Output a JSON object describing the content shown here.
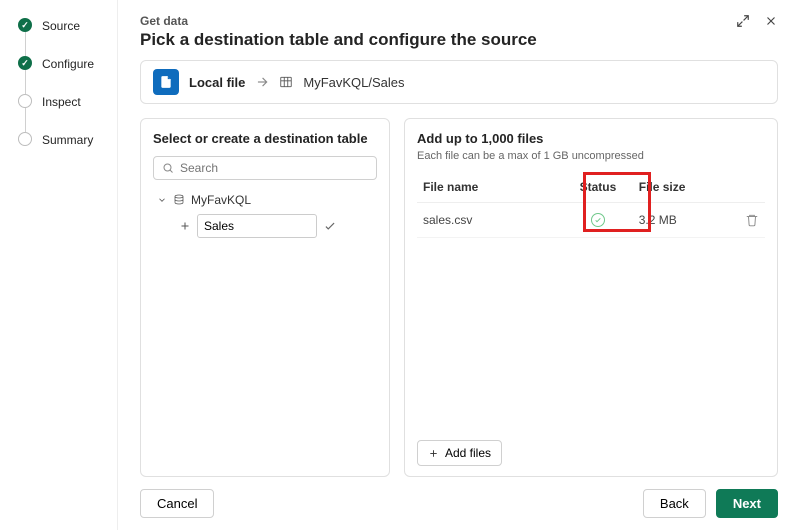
{
  "stepper": {
    "steps": [
      {
        "label": "Source",
        "state": "done"
      },
      {
        "label": "Configure",
        "state": "done"
      },
      {
        "label": "Inspect",
        "state": "todo"
      },
      {
        "label": "Summary",
        "state": "todo"
      }
    ]
  },
  "header": {
    "breadcrumb": "Get data",
    "title": "Pick a destination table and configure the source"
  },
  "sourcebar": {
    "source_label": "Local file",
    "destination_path": "MyFavKQL/Sales"
  },
  "leftPanel": {
    "title": "Select or create a destination table",
    "search_placeholder": "Search",
    "database_name": "MyFavKQL",
    "new_table_value": "Sales"
  },
  "rightPanel": {
    "title": "Add up to 1,000 files",
    "subtitle": "Each file can be a max of 1 GB uncompressed",
    "columns": {
      "name": "File name",
      "status": "Status",
      "size": "File size"
    },
    "rows": [
      {
        "name": "sales.csv",
        "status": "ok",
        "size": "3.2 MB"
      }
    ],
    "add_files_label": "Add files"
  },
  "footer": {
    "cancel": "Cancel",
    "back": "Back",
    "next": "Next"
  }
}
